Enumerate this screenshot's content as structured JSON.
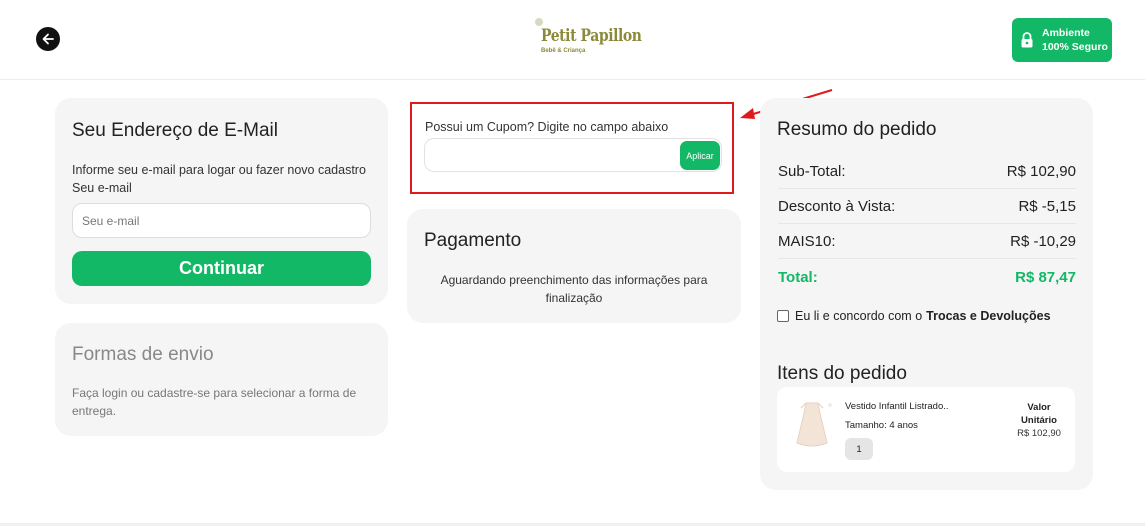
{
  "header": {
    "logo_text": "Petit Papillon",
    "logo_sub": "Bebê & Criança",
    "secure_line1": "Ambiente",
    "secure_line2": "100% Seguro",
    "accent": "#13b866"
  },
  "email": {
    "title": "Seu Endereço de E-Mail",
    "description": "Informe seu e-mail para logar ou fazer novo cadastro Seu e-mail",
    "placeholder": "Seu e-mail",
    "continue_label": "Continuar"
  },
  "shipping": {
    "title": "Formas de envio",
    "description": "Faça login ou cadastre-se para selecionar a forma de entrega."
  },
  "coupon": {
    "label": "Possui um Cupom? Digite no campo abaixo",
    "value": "",
    "apply_label": "Aplicar",
    "highlight_color": "#e0191e"
  },
  "payment": {
    "title": "Pagamento",
    "description": "Aguardando preenchimento das informações para finalização"
  },
  "summary": {
    "title": "Resumo do pedido",
    "rows": [
      {
        "label": "Sub-Total:",
        "value": "R$ 102,90"
      },
      {
        "label": "Desconto à Vista:",
        "value": "R$ -5,15"
      },
      {
        "label": "MAIS10:",
        "value": "R$ -10,29"
      }
    ],
    "total_label": "Total:",
    "total_value": "R$ 87,47",
    "agree_text": "Eu li e concordo com o",
    "agree_link": "Trocas e Devoluções"
  },
  "items": {
    "title": "Itens do pedido",
    "list": [
      {
        "name": "Vestido Infantil Listrado..",
        "size": "Tamanho: 4 anos",
        "qty": "1",
        "value_label_1": "Valor",
        "value_label_2": "Unitário",
        "price": "R$ 102,90"
      }
    ]
  }
}
